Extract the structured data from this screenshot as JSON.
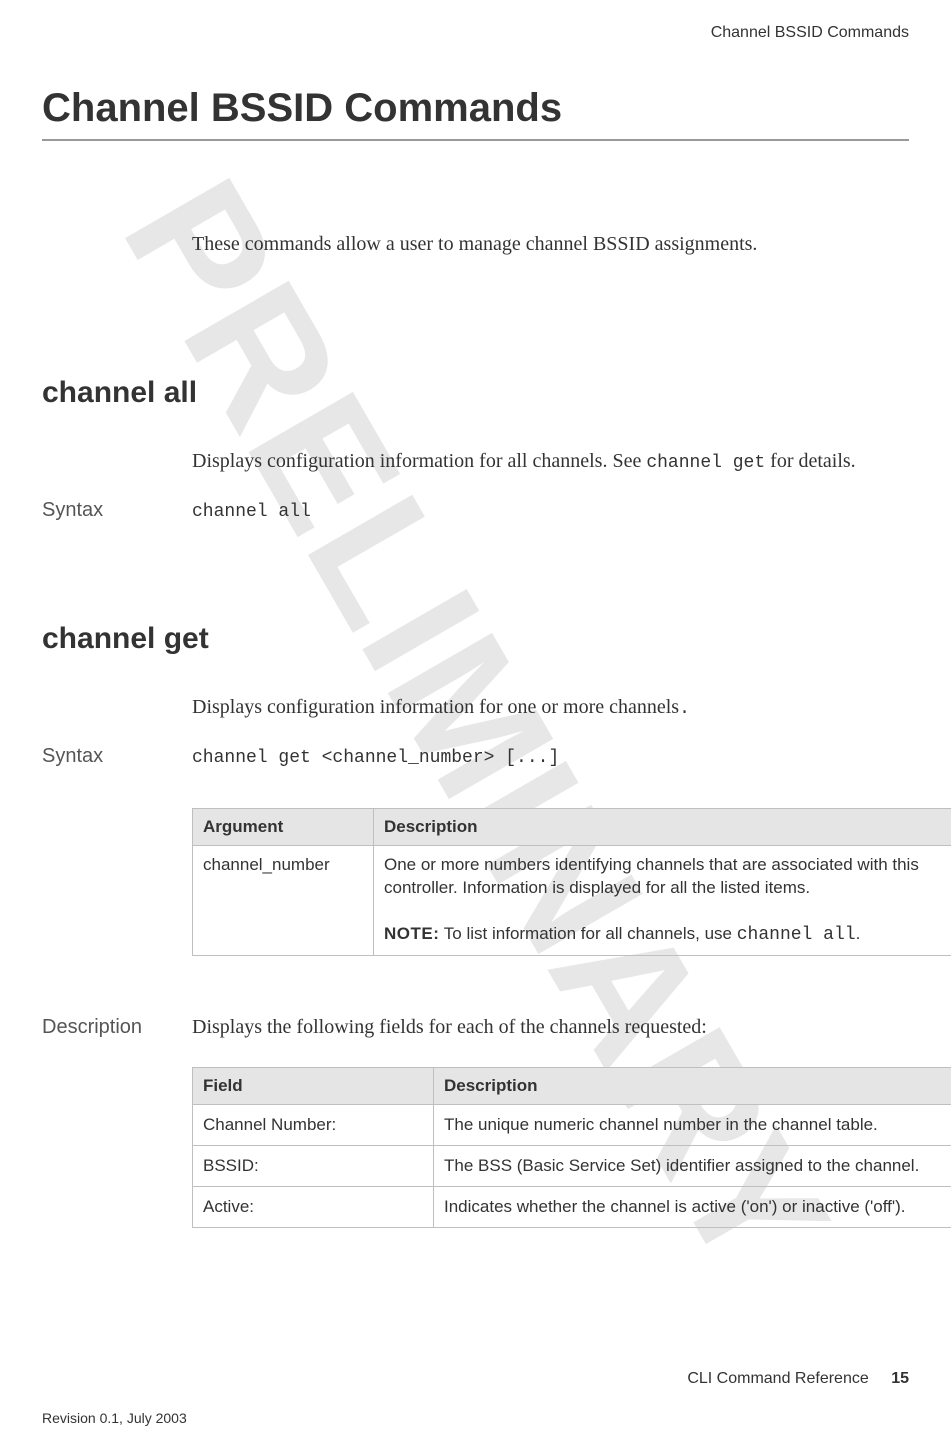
{
  "watermark": "PRELIMINARY",
  "running_head": "Channel BSSID Commands",
  "title": "Channel BSSID Commands",
  "intro": "These commands allow a user to manage channel BSSID assignments.",
  "sections": {
    "channel_all": {
      "heading": "channel all",
      "body_prefix": "Displays configuration information for all channels. See ",
      "body_code": "channel get",
      "body_suffix": " for details.",
      "syntax_label": "Syntax",
      "syntax_value": "channel all"
    },
    "channel_get": {
      "heading": "channel get",
      "body_text": "Displays configuration information for one or more channels",
      "body_trailing_mono": ".",
      "syntax_label": "Syntax",
      "syntax_value": "channel get <channel_number> [...]",
      "arg_table": {
        "headers": {
          "arg": "Argument",
          "desc": "Description"
        },
        "row": {
          "arg": "channel_number",
          "desc_line1": "One or more numbers identifying channels that are associated with this controller. Information is displayed for all the listed items.",
          "note_label": "NOTE:",
          "note_text_prefix": "  To list information for all channels, use ",
          "note_code": "channel all",
          "note_text_suffix": "."
        }
      },
      "description_label": "Description",
      "description_text": "Displays the following fields for each of the channels requested:",
      "field_table": {
        "headers": {
          "field": "Field",
          "desc": "Description"
        },
        "rows": [
          {
            "field": "Channel Number:",
            "desc": "The unique numeric channel number in the channel table."
          },
          {
            "field": "BSSID:",
            "desc": "The BSS (Basic Service Set) identifier assigned to the channel."
          },
          {
            "field": "Active:",
            "desc": "Indicates whether the channel is active ('on') or inactive ('off')."
          }
        ]
      }
    }
  },
  "footer": {
    "doc_title": "CLI Command Reference",
    "page_number": "15",
    "revision": "Revision 0.1, July 2003"
  }
}
